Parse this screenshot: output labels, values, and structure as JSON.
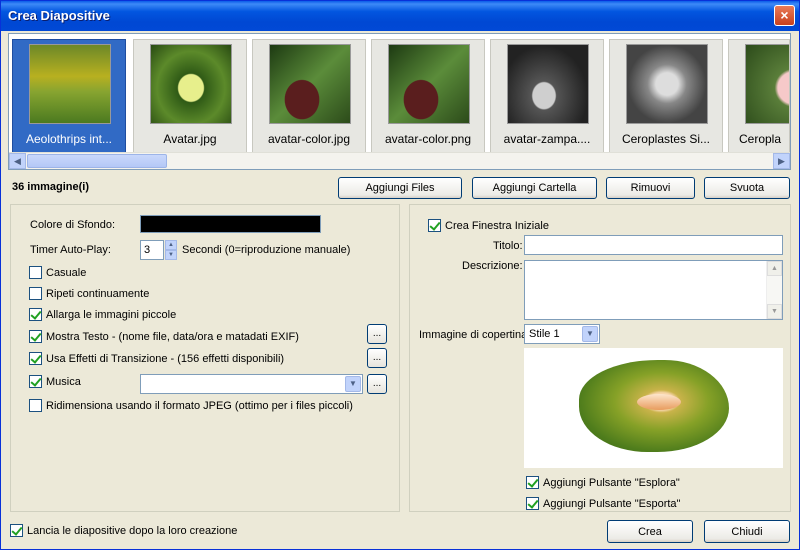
{
  "window": {
    "title": "Crea Diapositive",
    "close_label": "×"
  },
  "thumbnails": [
    {
      "caption": "Aeolothrips int...",
      "selected": true
    },
    {
      "caption": "Avatar.jpg"
    },
    {
      "caption": "avatar-color.jpg"
    },
    {
      "caption": "avatar-color.png"
    },
    {
      "caption": "avatar-zampa...."
    },
    {
      "caption": "Ceroplastes Si..."
    },
    {
      "caption": "Ceropla"
    }
  ],
  "scroll": {
    "left": "◀",
    "right": "▶"
  },
  "toolbar": {
    "count": "36 immagine(i)",
    "add_files": "Aggiungi Files",
    "add_folder": "Aggiungi Cartella",
    "remove": "Rimuovi",
    "clear": "Svuota"
  },
  "left": {
    "bg_color_label": "Colore di Sfondo:",
    "bg_color": "#000000",
    "timer_label": "Timer Auto-Play:",
    "timer_value": "3",
    "timer_suffix": "Secondi (0=riproduzione manuale)",
    "casuale": "Casuale",
    "ripeti": "Ripeti continuamente",
    "allarga": "Allarga le immagini piccole",
    "mostra_testo": "Mostra Testo - (nome file, data/ora e matadati EXIF)",
    "effetti": "Usa Effetti di Transizione - (156 effetti disponibili)",
    "musica": "Musica",
    "musica_value": "",
    "ridimensiona": "Ridimensiona usando il formato JPEG (ottimo per i files piccoli)",
    "ellipsis": "..."
  },
  "right": {
    "crea_finestra": "Crea Finestra Iniziale",
    "titolo_label": "Titolo:",
    "titolo_value": "",
    "descrizione_label": "Descrizione:",
    "descrizione_value": "",
    "copertina_label": "Immagine di copertina:",
    "copertina_value": "Stile 1",
    "esplora": "Aggiungi Pulsante \"Esplora\"",
    "esporta": "Aggiungi Pulsante \"Esporta\""
  },
  "footer": {
    "lancia": "Lancia le diapositive dopo la loro creazione",
    "crea": "Crea",
    "chiudi": "Chiudi"
  },
  "icons": {
    "drop": "▼",
    "up": "▲",
    "down": "▼"
  }
}
